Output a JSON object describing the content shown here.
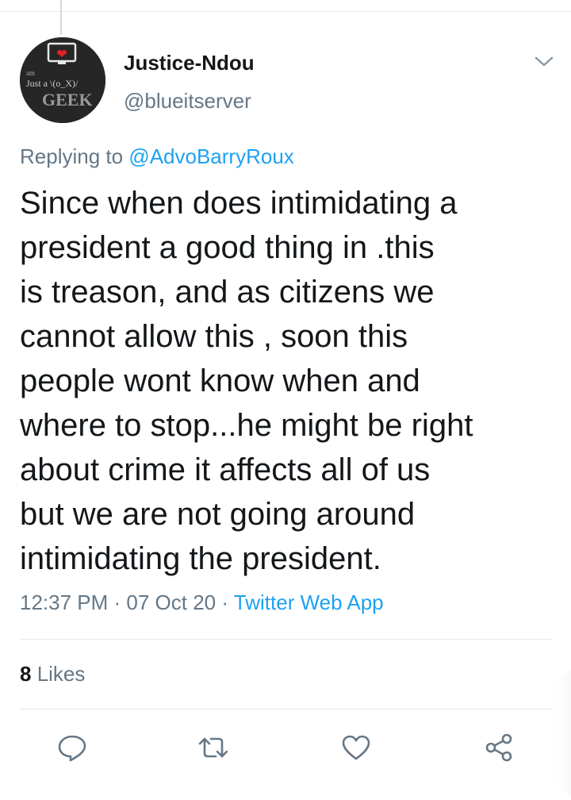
{
  "user": {
    "display_name": "Justice-Ndou",
    "handle": "@blueitserver",
    "avatar_text": {
      "line1": "am",
      "line2": "Just a \\(o_X)/",
      "line3": "GEEK"
    }
  },
  "reply": {
    "prefix": "Replying to ",
    "mention": "@AdvoBarryRoux"
  },
  "tweet": {
    "text": "Since when does intimidating a\npresident a good thing in .this\nis treason, and as citizens we\ncannot allow this , soon this\npeople wont know when and\nwhere to stop...he might be right\nabout crime it affects all of us\nbut we are not going around\nintimidating the president."
  },
  "meta": {
    "time": "12:37 PM",
    "separator": " · ",
    "date": "07 Oct 20",
    "source": "Twitter Web App"
  },
  "stats": {
    "likes_count": "8",
    "likes_label": " Likes"
  },
  "icons": {
    "menu": "chevron-down-icon",
    "reply": "reply-bubble-icon",
    "retweet": "retweet-icon",
    "like": "heart-icon",
    "share": "share-icon"
  },
  "colors": {
    "text": "#14171a",
    "secondary": "#657786",
    "accent": "#1da1f2",
    "divider": "#e1e8ed"
  }
}
